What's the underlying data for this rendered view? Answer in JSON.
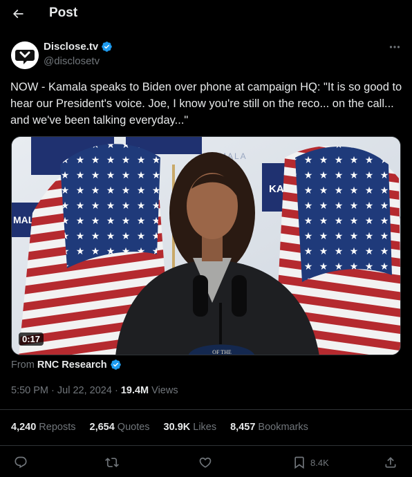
{
  "header": {
    "title": "Post"
  },
  "author": {
    "name": "Disclose.tv",
    "handle": "@disclosetv"
  },
  "tweet": {
    "text": "NOW - Kamala speaks to Biden over phone at campaign HQ: \"It is so good to hear our President's voice. Joe, I know you're still on the reco... on the call... and we've been talking everyday...\""
  },
  "media": {
    "duration": "0:17",
    "background_signs": [
      "KAM",
      "MALA",
      "MALA",
      "LA"
    ],
    "podium_seal_text": "OF THE"
  },
  "source": {
    "prefix": "From",
    "name": "RNC Research"
  },
  "meta": {
    "time": "5:50 PM",
    "sep1": "·",
    "date": "Jul 22, 2024",
    "sep2": "·",
    "views": "19.4M",
    "views_label": "Views"
  },
  "stats": {
    "reposts": "4,240",
    "reposts_label": "Reposts",
    "quotes": "2,654",
    "quotes_label": "Quotes",
    "likes": "30.9K",
    "likes_label": "Likes",
    "bookmarks": "8,457",
    "bookmarks_label": "Bookmarks"
  },
  "actions": {
    "bookmark_count": "8.4K"
  },
  "colors": {
    "background": "#000000",
    "text": "#e7e9ea",
    "secondary": "#71767b",
    "divider": "#2f3336",
    "verified": "#1d9bf0"
  }
}
